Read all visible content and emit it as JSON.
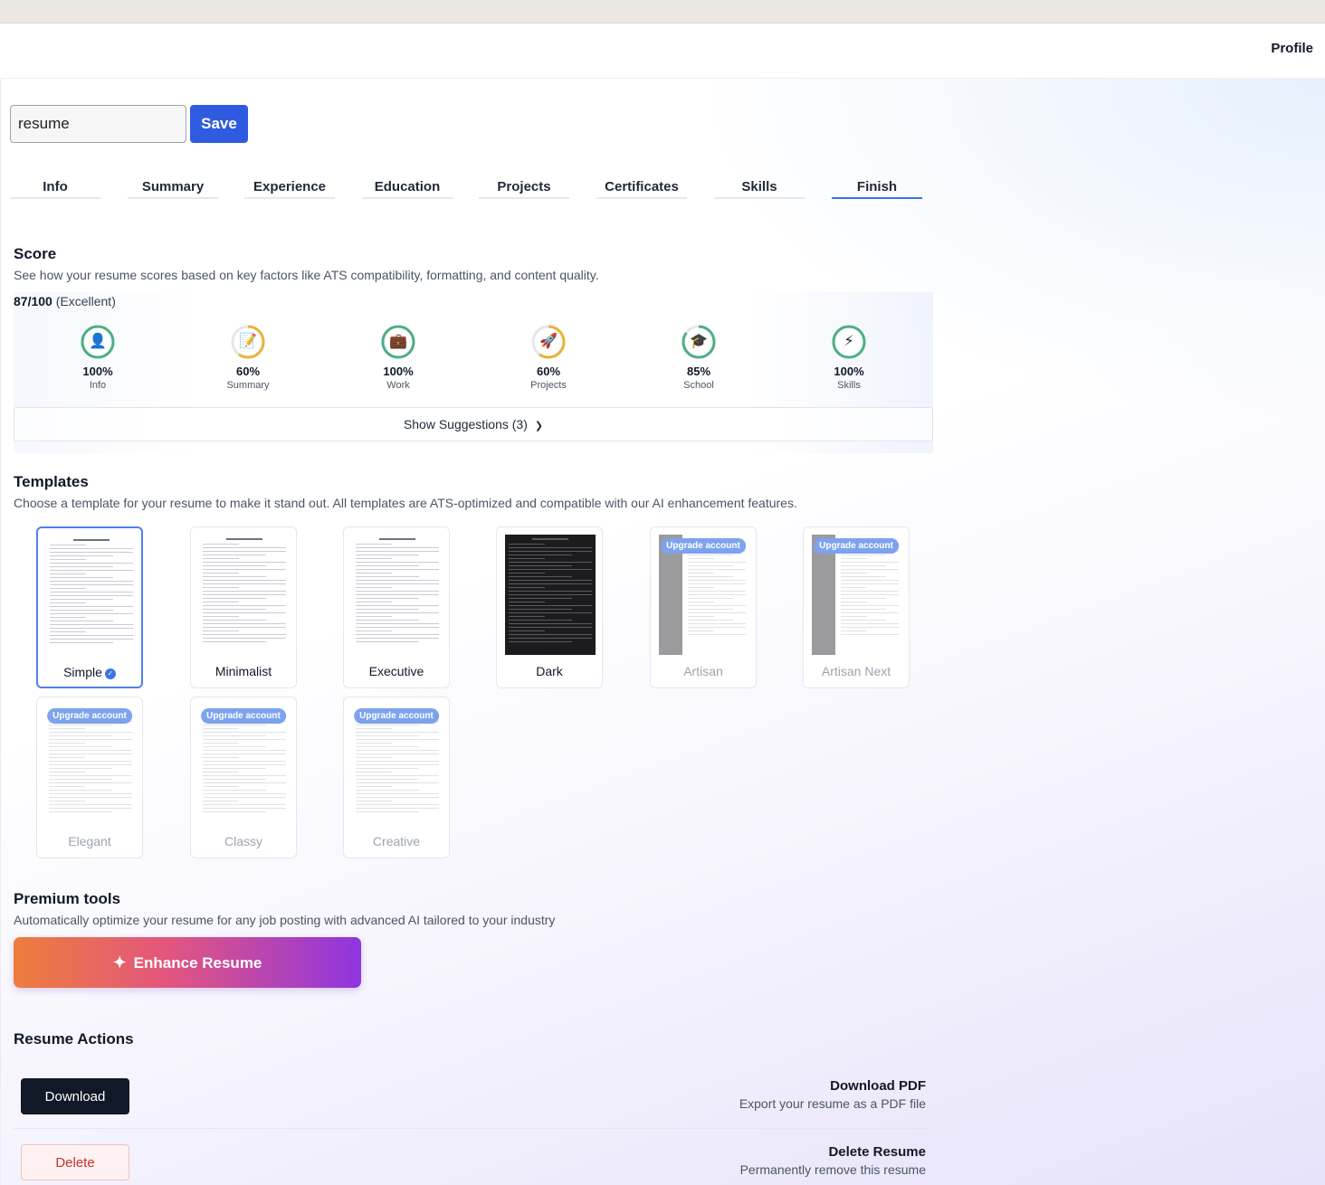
{
  "header": {
    "profile_label": "Profile"
  },
  "resume_name": {
    "value": "resume"
  },
  "save_label": "Save",
  "tabs": [
    {
      "label": "Info"
    },
    {
      "label": "Summary"
    },
    {
      "label": "Experience"
    },
    {
      "label": "Education"
    },
    {
      "label": "Projects"
    },
    {
      "label": "Certificates"
    },
    {
      "label": "Skills"
    },
    {
      "label": "Finish",
      "active": true
    }
  ],
  "score": {
    "title": "Score",
    "description": "See how your resume scores based on key factors like ATS compatibility, formatting, and content quality.",
    "total": "87/100",
    "rating": "(Excellent)",
    "metrics": [
      {
        "percent": "100%",
        "label": "Info",
        "value": 1.0,
        "icon": "person-icon",
        "glyph": "👤",
        "color": "#4caf84"
      },
      {
        "percent": "60%",
        "label": "Summary",
        "value": 0.6,
        "icon": "memo-icon",
        "glyph": "📝",
        "color": "#e8b23a"
      },
      {
        "percent": "100%",
        "label": "Work",
        "value": 1.0,
        "icon": "briefcase-icon",
        "glyph": "💼",
        "color": "#4caf84"
      },
      {
        "percent": "60%",
        "label": "Projects",
        "value": 0.6,
        "icon": "rocket-icon",
        "glyph": "🚀",
        "color": "#e8b23a"
      },
      {
        "percent": "85%",
        "label": "School",
        "value": 0.85,
        "icon": "graduation-cap-icon",
        "glyph": "🎓",
        "color": "#4caf84"
      },
      {
        "percent": "100%",
        "label": "Skills",
        "value": 1.0,
        "icon": "lightning-icon",
        "glyph": "⚡",
        "color": "#4caf84"
      }
    ],
    "suggestions_label": "Show Suggestions (3)"
  },
  "templates": {
    "title": "Templates",
    "description": "Choose a template for your resume to make it stand out. All templates are ATS-optimized and compatible with our AI enhancement features.",
    "upgrade_label": "Upgrade account",
    "items": [
      {
        "name": "Simple",
        "selected": true,
        "locked": false
      },
      {
        "name": "Minimalist",
        "selected": false,
        "locked": false
      },
      {
        "name": "Executive",
        "selected": false,
        "locked": false
      },
      {
        "name": "Dark",
        "selected": false,
        "locked": false
      },
      {
        "name": "Artisan",
        "selected": false,
        "locked": true
      },
      {
        "name": "Artisan Next",
        "selected": false,
        "locked": true
      },
      {
        "name": "Elegant",
        "selected": false,
        "locked": true
      },
      {
        "name": "Classy",
        "selected": false,
        "locked": true
      },
      {
        "name": "Creative",
        "selected": false,
        "locked": true
      }
    ]
  },
  "premium": {
    "title": "Premium tools",
    "description": "Automatically optimize your resume for any job posting with advanced AI tailored to your industry",
    "enhance_label": "Enhance Resume"
  },
  "actions": {
    "title": "Resume Actions",
    "download": {
      "button": "Download",
      "title": "Download PDF",
      "description": "Export your resume as a PDF file"
    },
    "delete": {
      "button": "Delete",
      "title": "Delete Resume",
      "description": "Permanently remove this resume"
    }
  }
}
